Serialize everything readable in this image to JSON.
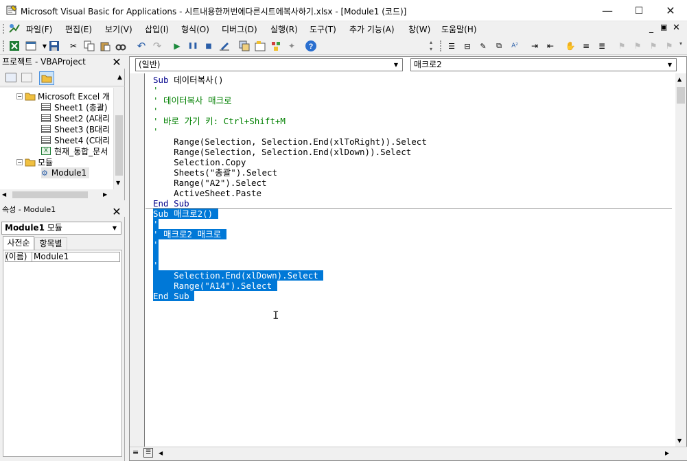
{
  "window": {
    "title": "Microsoft Visual Basic for Applications - 시트내용한꺼번에다른시트에복사하기.xlsx - [Module1 (코드)]",
    "min": "—",
    "max": "☐",
    "close": "✕"
  },
  "menu": [
    "파일(F)",
    "편집(E)",
    "보기(V)",
    "삽입(I)",
    "형식(O)",
    "디버그(D)",
    "실행(R)",
    "도구(T)",
    "추가 기능(A)",
    "창(W)",
    "도움말(H)"
  ],
  "project": {
    "title": "프로젝트 - VBAProject",
    "root": "Microsoft Excel 개",
    "sheets": [
      "Sheet1 (총괄)",
      "Sheet2 (A대리",
      "Sheet3 (B대리",
      "Sheet4 (C대리",
      "현재_통합_문서"
    ],
    "modules_folder": "모듈",
    "module": "Module1"
  },
  "properties": {
    "title": "속성 - Module1",
    "object": "Module1",
    "object_type": "모듈",
    "tab1": "사전순",
    "tab2": "항목별",
    "prop_name": "(이름)",
    "prop_value": "Module1"
  },
  "code": {
    "object_combo": "(일반)",
    "proc_combo": "매크로2",
    "lines1": [
      {
        "kind": "kw",
        "text": "Sub 데이터복사()"
      },
      {
        "kind": "cm",
        "text": "'"
      },
      {
        "kind": "cm",
        "text": "' 데이터복사 매크로"
      },
      {
        "kind": "cm",
        "text": "'"
      },
      {
        "kind": "cm",
        "text": "' 바로 가기 키: Ctrl+Shift+M"
      },
      {
        "kind": "cm",
        "text": "'"
      },
      {
        "kind": "code",
        "text": "    Range(Selection, Selection.End(xlToRight)).Select"
      },
      {
        "kind": "code",
        "text": "    Range(Selection, Selection.End(xlDown)).Select"
      },
      {
        "kind": "code",
        "text": "    Selection.Copy"
      },
      {
        "kind": "code",
        "text": "    Sheets(\"총괄\").Select"
      },
      {
        "kind": "code",
        "text": "    Range(\"A2\").Select"
      },
      {
        "kind": "code",
        "text": "    ActiveSheet.Paste"
      },
      {
        "kind": "kw",
        "text": "End Sub"
      }
    ],
    "lines2": [
      {
        "kind": "sel",
        "text": "Sub 매크로2() "
      },
      {
        "kind": "sel",
        "text": "'"
      },
      {
        "kind": "sel",
        "text": "' 매크로2 매크로 "
      },
      {
        "kind": "sel",
        "text": "'"
      },
      {
        "kind": "sel",
        "text": " "
      },
      {
        "kind": "sel",
        "text": "'"
      },
      {
        "kind": "sel",
        "text": "    Selection.End(xlDown).Select "
      },
      {
        "kind": "sel",
        "text": "    Range(\"A14\").Select "
      },
      {
        "kind": "sel",
        "text": "End Sub "
      }
    ]
  },
  "cursor": "I"
}
